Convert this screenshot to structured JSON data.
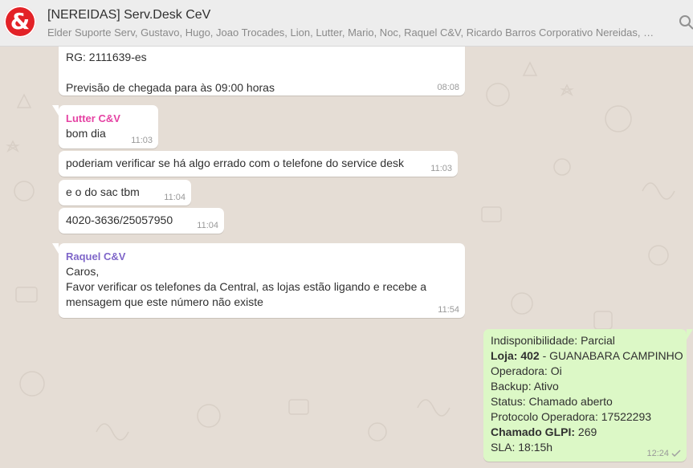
{
  "header": {
    "avatar_glyph": "&",
    "title": "[NEREIDAS] Serv.Desk CeV",
    "participants": "Elder Suporte Serv, Gustavo, Hugo, Joao Trocades, Lion, Lutter, Mario, Noc, Raquel C&V, Ricardo Barros Corporativo Nereidas, Serv...",
    "icons": [
      "avatar",
      "search-icon"
    ]
  },
  "messages": [
    {
      "text1": "RG: 2111639-es",
      "text2": "Previsão de chegada para às 09:00 horas",
      "time": "08:08"
    },
    {
      "sender": "Lutter C&V",
      "sender_color": "#e542a3",
      "text": "bom dia",
      "time": "11:03"
    },
    {
      "text": "poderiam verificar se há algo errado com o telefone do service desk",
      "time": "11:03"
    },
    {
      "text": "e o do sac tbm",
      "time": "11:04"
    },
    {
      "text": "4020-3636/25057950",
      "time": "11:04"
    },
    {
      "sender": "Raquel C&V",
      "sender_color": "#7f66c9",
      "lines": [
        "Caros,",
        "Favor verificar os telefones da Central, as lojas estão ligando e recebe a",
        "mensagem que este número não existe"
      ],
      "time": "11:54"
    },
    {
      "outgoing": true,
      "line1": "Indisponibilidade: Parcial",
      "loja_label": "Loja: 402",
      "loja_value": " - GUANABARA CAMPINHO",
      "line3": "Operadora: Oi",
      "line4": "Backup: Ativo",
      "line5": "Status: Chamado aberto",
      "line6": "Protocolo Operadora: 17522293",
      "glpi_label": "Chamado GLPI:",
      "glpi_value": " 269",
      "line8": "SLA: 18:15h",
      "time": "12:24",
      "status": "delivered"
    }
  ],
  "colors": {
    "background": "#e5ddd5",
    "incoming": "#ffffff",
    "outgoing": "#dcf8c6"
  }
}
